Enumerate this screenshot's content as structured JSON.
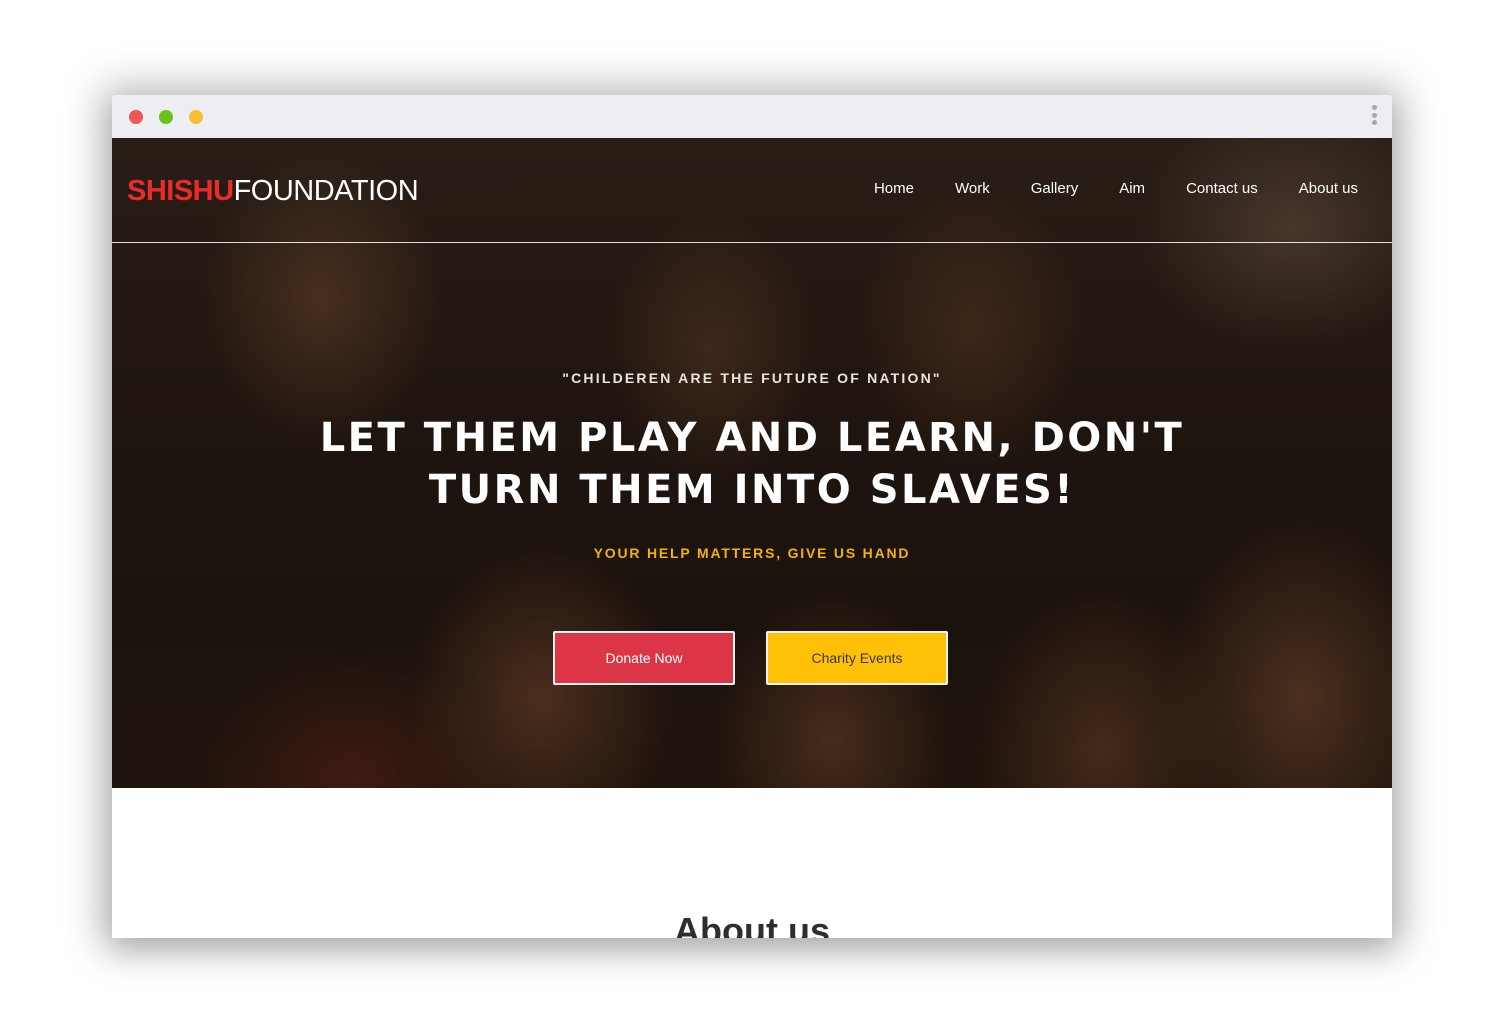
{
  "brand": {
    "part1": "SHISHU",
    "part2": "FOUNDATION",
    "accent_color": "#ec2a2a"
  },
  "nav": {
    "items": [
      {
        "label": "Home"
      },
      {
        "label": "Work"
      },
      {
        "label": "Gallery"
      },
      {
        "label": "Aim"
      },
      {
        "label": "Contact us"
      },
      {
        "label": "About us"
      }
    ]
  },
  "hero": {
    "kicker": "\"CHILDEREN ARE THE FUTURE OF NATION\"",
    "headline": "LET THEM PLAY AND LEARN, DON'T TURN THEM INTO SLAVES!",
    "tagline": "YOUR HELP MATTERS, GIVE US HAND",
    "tagline_color": "#f2b305",
    "buttons": {
      "donate": {
        "label": "Donate Now",
        "color": "#dc3545"
      },
      "events": {
        "label": "Charity Events",
        "color": "#ffc107"
      }
    }
  },
  "about": {
    "heading": "About us"
  },
  "browser": {
    "traffic_lights": [
      "#f25656",
      "#6ac11a",
      "#f8bd34"
    ],
    "menu_icon": "kebab-icon"
  }
}
